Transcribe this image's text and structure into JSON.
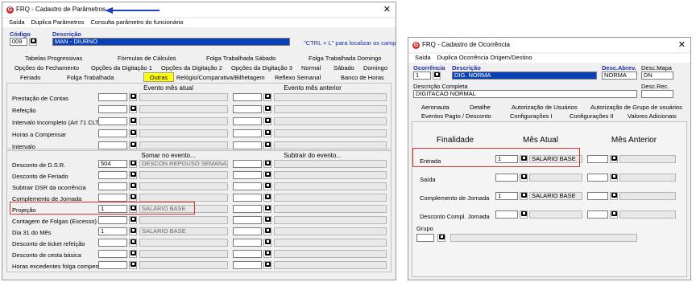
{
  "win1": {
    "title": "FRQ - Cadastro de Parâmetros",
    "close": "✕",
    "menu": [
      "Saída",
      "Duplica Parâmetros",
      "Consulta parâmetro do funcionário"
    ],
    "codigo_label": "Código",
    "codigo_value": "009",
    "descricao_label": "Descrição",
    "descricao_value": "MAN - DIURNO",
    "hint": "\"CTRL + L\" para localizar os campos",
    "tabs_row1": [
      "Tabelas Progressivas",
      "Fórmulas de Cálculos",
      "Folga Trabalhada Sábado",
      "Folga Trabalhada Domingo"
    ],
    "tabs_row2": [
      "Opções do Fechamento",
      "Opções da Digitação 1",
      "Opções da Digitação 2",
      "Opções da Digitação 3",
      "Normal",
      "Sábado",
      "Domingo"
    ],
    "tabs_row3": [
      "Feriado",
      "Folga Trabalhada",
      "Outras",
      "Relógio/Comparativa/Bilhetagem",
      "Reflexo Semanal",
      "Banco de Horas"
    ],
    "sec1_h1": "Evento mês atual",
    "sec1_h2": "Evento mês anterior",
    "sec1_rows": [
      "Prestação de Contas",
      "Refeição",
      "Intervalo Incompleto (Art 71 CLT)",
      "Horas a Compensar",
      "Intervalo"
    ],
    "sec2_h1": "Somar no evento...",
    "sec2_h2": "Subtrair do evento...",
    "sec2_rows": [
      {
        "label": "Desconto de D.S.R.",
        "code": "504",
        "desc": "DESCON REPOUSO SEMANAL"
      },
      {
        "label": "Desconto de Feriado",
        "code": "",
        "desc": ""
      },
      {
        "label": "Subtrair DSR da ocorrência",
        "code": "",
        "desc": ""
      },
      {
        "label": "Complemento de Jornada",
        "code": "",
        "desc": ""
      },
      {
        "label": "Projeção",
        "code": "1",
        "desc": "SALARIO BASE"
      },
      {
        "label": "Contagem de Folgas (Excesso)",
        "code": "",
        "desc": ""
      },
      {
        "label": "Dia 31 do Mês",
        "code": "1",
        "desc": "SALARIO BASE"
      },
      {
        "label": "Desconto de ticket refeição",
        "code": "",
        "desc": ""
      },
      {
        "label": "Desconto de cesta básica",
        "code": "",
        "desc": ""
      },
      {
        "label": "Horas excedentes folga compens.",
        "code": "",
        "desc": ""
      }
    ]
  },
  "win2": {
    "title": "FRQ - Cadastro de Ocorrência",
    "close": "✕",
    "menu": [
      "Saída",
      "Duplica Ocorrência Origem/Destino"
    ],
    "ocorrencia_label": "Ocorrência",
    "ocorrencia_value": "1",
    "descricao_label": "Descrição",
    "descricao_value": "DIG. NORMA",
    "abrev_label": "Desc.Abrev.",
    "abrev_value": "NORMA",
    "mapa_label": "Desc.Mapa",
    "mapa_value": "DN",
    "completa_label": "Descrição Completa",
    "completa_value": "DIGITACAO NORMAL",
    "rec_label": "Desc.Rec.",
    "tabs_row1": [
      "Aeronauta",
      "Detalhe",
      "Autorização de Usuários",
      "Autorização de Grupo de usuários"
    ],
    "tabs_row2": [
      "Eventos Pagto / Desconto",
      "Configurações I",
      "Configurações II",
      "Valores Adicionais"
    ],
    "col_finalidade": "Finalidade",
    "col_atual": "Mês Atual",
    "col_anterior": "Mês Anterior",
    "rows": [
      {
        "label": "Entrada",
        "code": "1",
        "desc": "SALARIO BASE"
      },
      {
        "label": "Saída",
        "code": "",
        "desc": ""
      },
      {
        "label": "Complemento de Jornada",
        "code": "1",
        "desc": "SALARIO BASE"
      },
      {
        "label": "Desconto Compl. Jornada",
        "code": "",
        "desc": ""
      }
    ],
    "grupo_label": "Grupo"
  },
  "colors": {
    "red": "#d63232",
    "arrow": "#1f3fbf",
    "highlight": "#ffff00",
    "selection": "#0a3fb5"
  }
}
